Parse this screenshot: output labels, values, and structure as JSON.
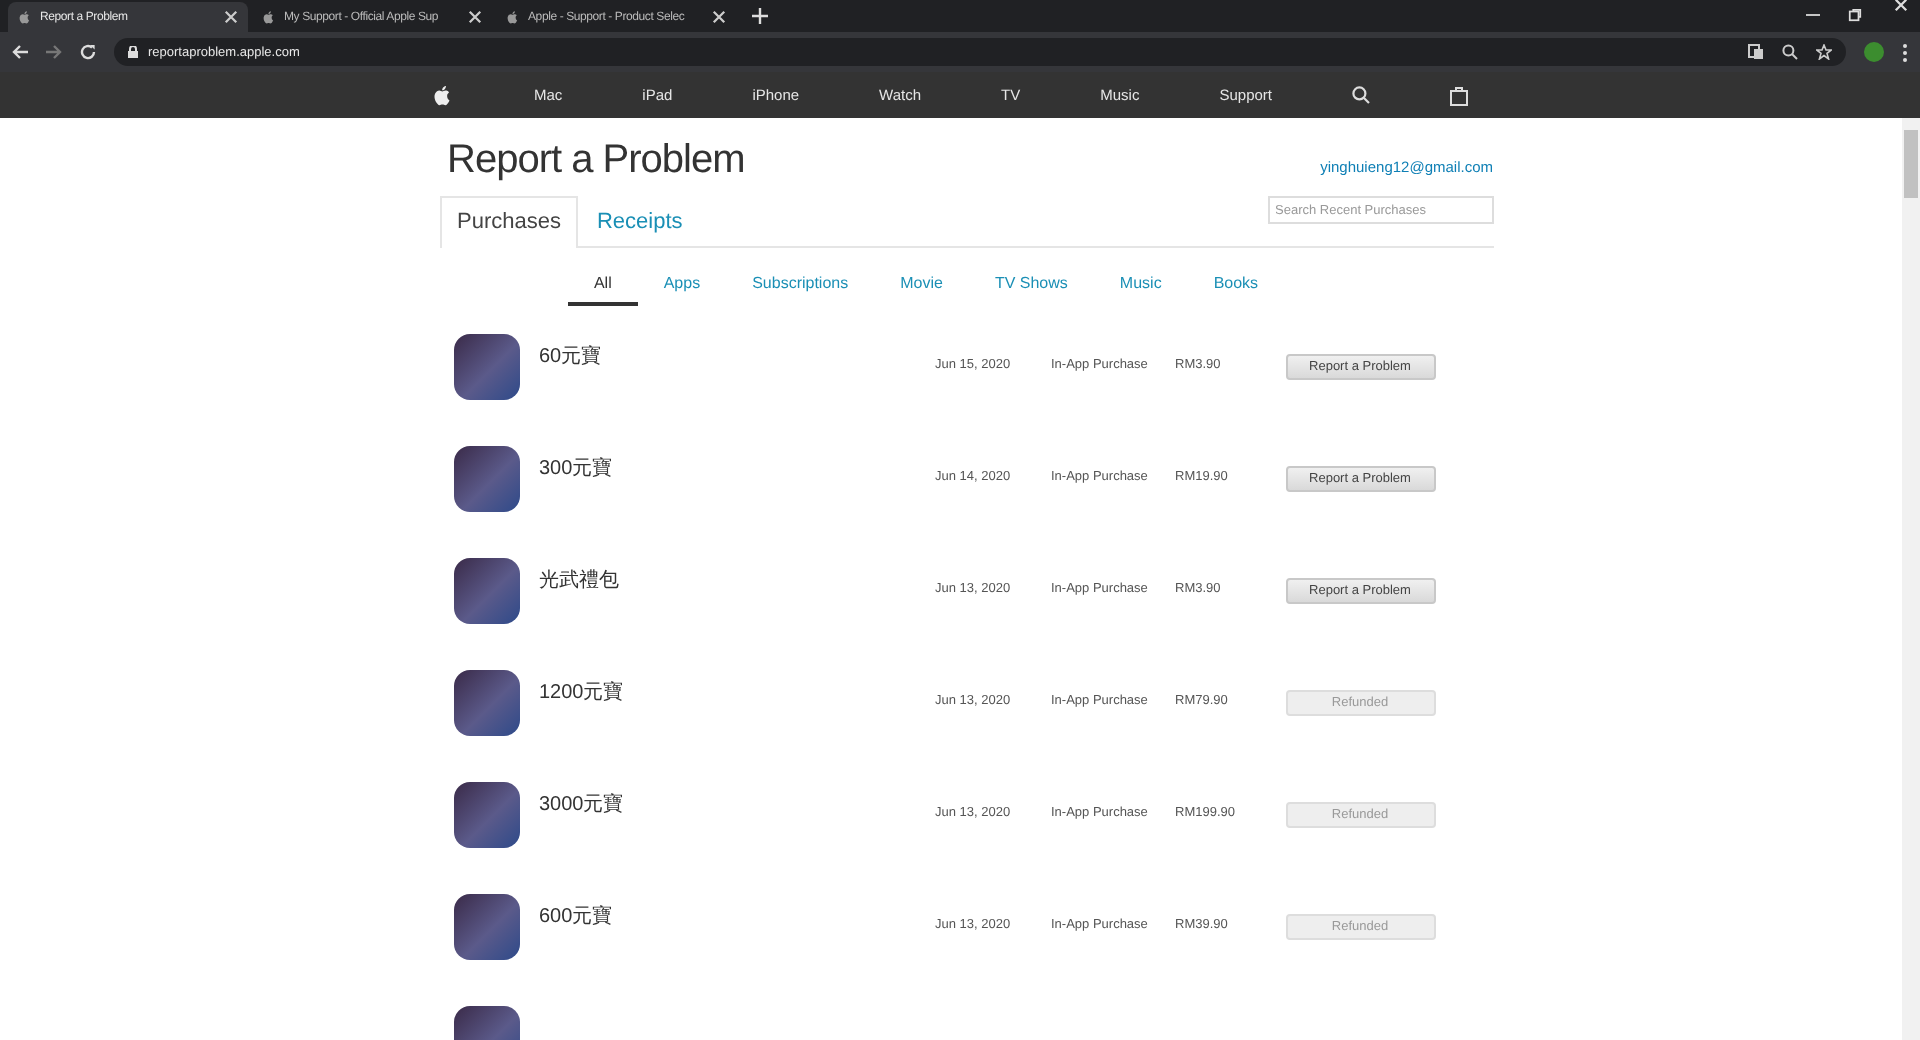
{
  "browser": {
    "tabs": [
      {
        "title": "Report a Problem",
        "selected": true
      },
      {
        "title": "My Support - Official Apple Sup",
        "selected": false
      },
      {
        "title": "Apple - Support - Product Selec",
        "selected": false
      }
    ],
    "url": "reportaproblem.apple.com"
  },
  "nav": {
    "items": [
      "Mac",
      "iPad",
      "iPhone",
      "Watch",
      "TV",
      "Music",
      "Support"
    ]
  },
  "page": {
    "title": "Report a Problem",
    "account": "yinghuieng12@gmail.com",
    "search": {
      "placeholder": "Search Recent Purchases"
    },
    "tabs": [
      {
        "label": "Purchases",
        "selected": true
      },
      {
        "label": "Receipts",
        "selected": false
      }
    ],
    "filters": [
      {
        "label": "All",
        "selected": true
      },
      {
        "label": "Apps",
        "selected": false
      },
      {
        "label": "Subscriptions",
        "selected": false
      },
      {
        "label": "Movie",
        "selected": false
      },
      {
        "label": "TV Shows",
        "selected": false
      },
      {
        "label": "Music",
        "selected": false
      },
      {
        "label": "Books",
        "selected": false
      }
    ],
    "purchases": [
      {
        "name": "60元寶",
        "date": "Jun 15, 2020",
        "type": "In-App Purchase",
        "price": "RM3.90",
        "action": "Report a Problem",
        "disabled": false
      },
      {
        "name": "300元寶",
        "date": "Jun 14, 2020",
        "type": "In-App Purchase",
        "price": "RM19.90",
        "action": "Report a Problem",
        "disabled": false
      },
      {
        "name": "光武禮包",
        "date": "Jun 13, 2020",
        "type": "In-App Purchase",
        "price": "RM3.90",
        "action": "Report a Problem",
        "disabled": false
      },
      {
        "name": "1200元寶",
        "date": "Jun 13, 2020",
        "type": "In-App Purchase",
        "price": "RM79.90",
        "action": "Refunded",
        "disabled": true
      },
      {
        "name": "3000元寶",
        "date": "Jun 13, 2020",
        "type": "In-App Purchase",
        "price": "RM199.90",
        "action": "Refunded",
        "disabled": true
      },
      {
        "name": "600元寶",
        "date": "Jun 13, 2020",
        "type": "In-App Purchase",
        "price": "RM39.90",
        "action": "Refunded",
        "disabled": true
      }
    ]
  }
}
